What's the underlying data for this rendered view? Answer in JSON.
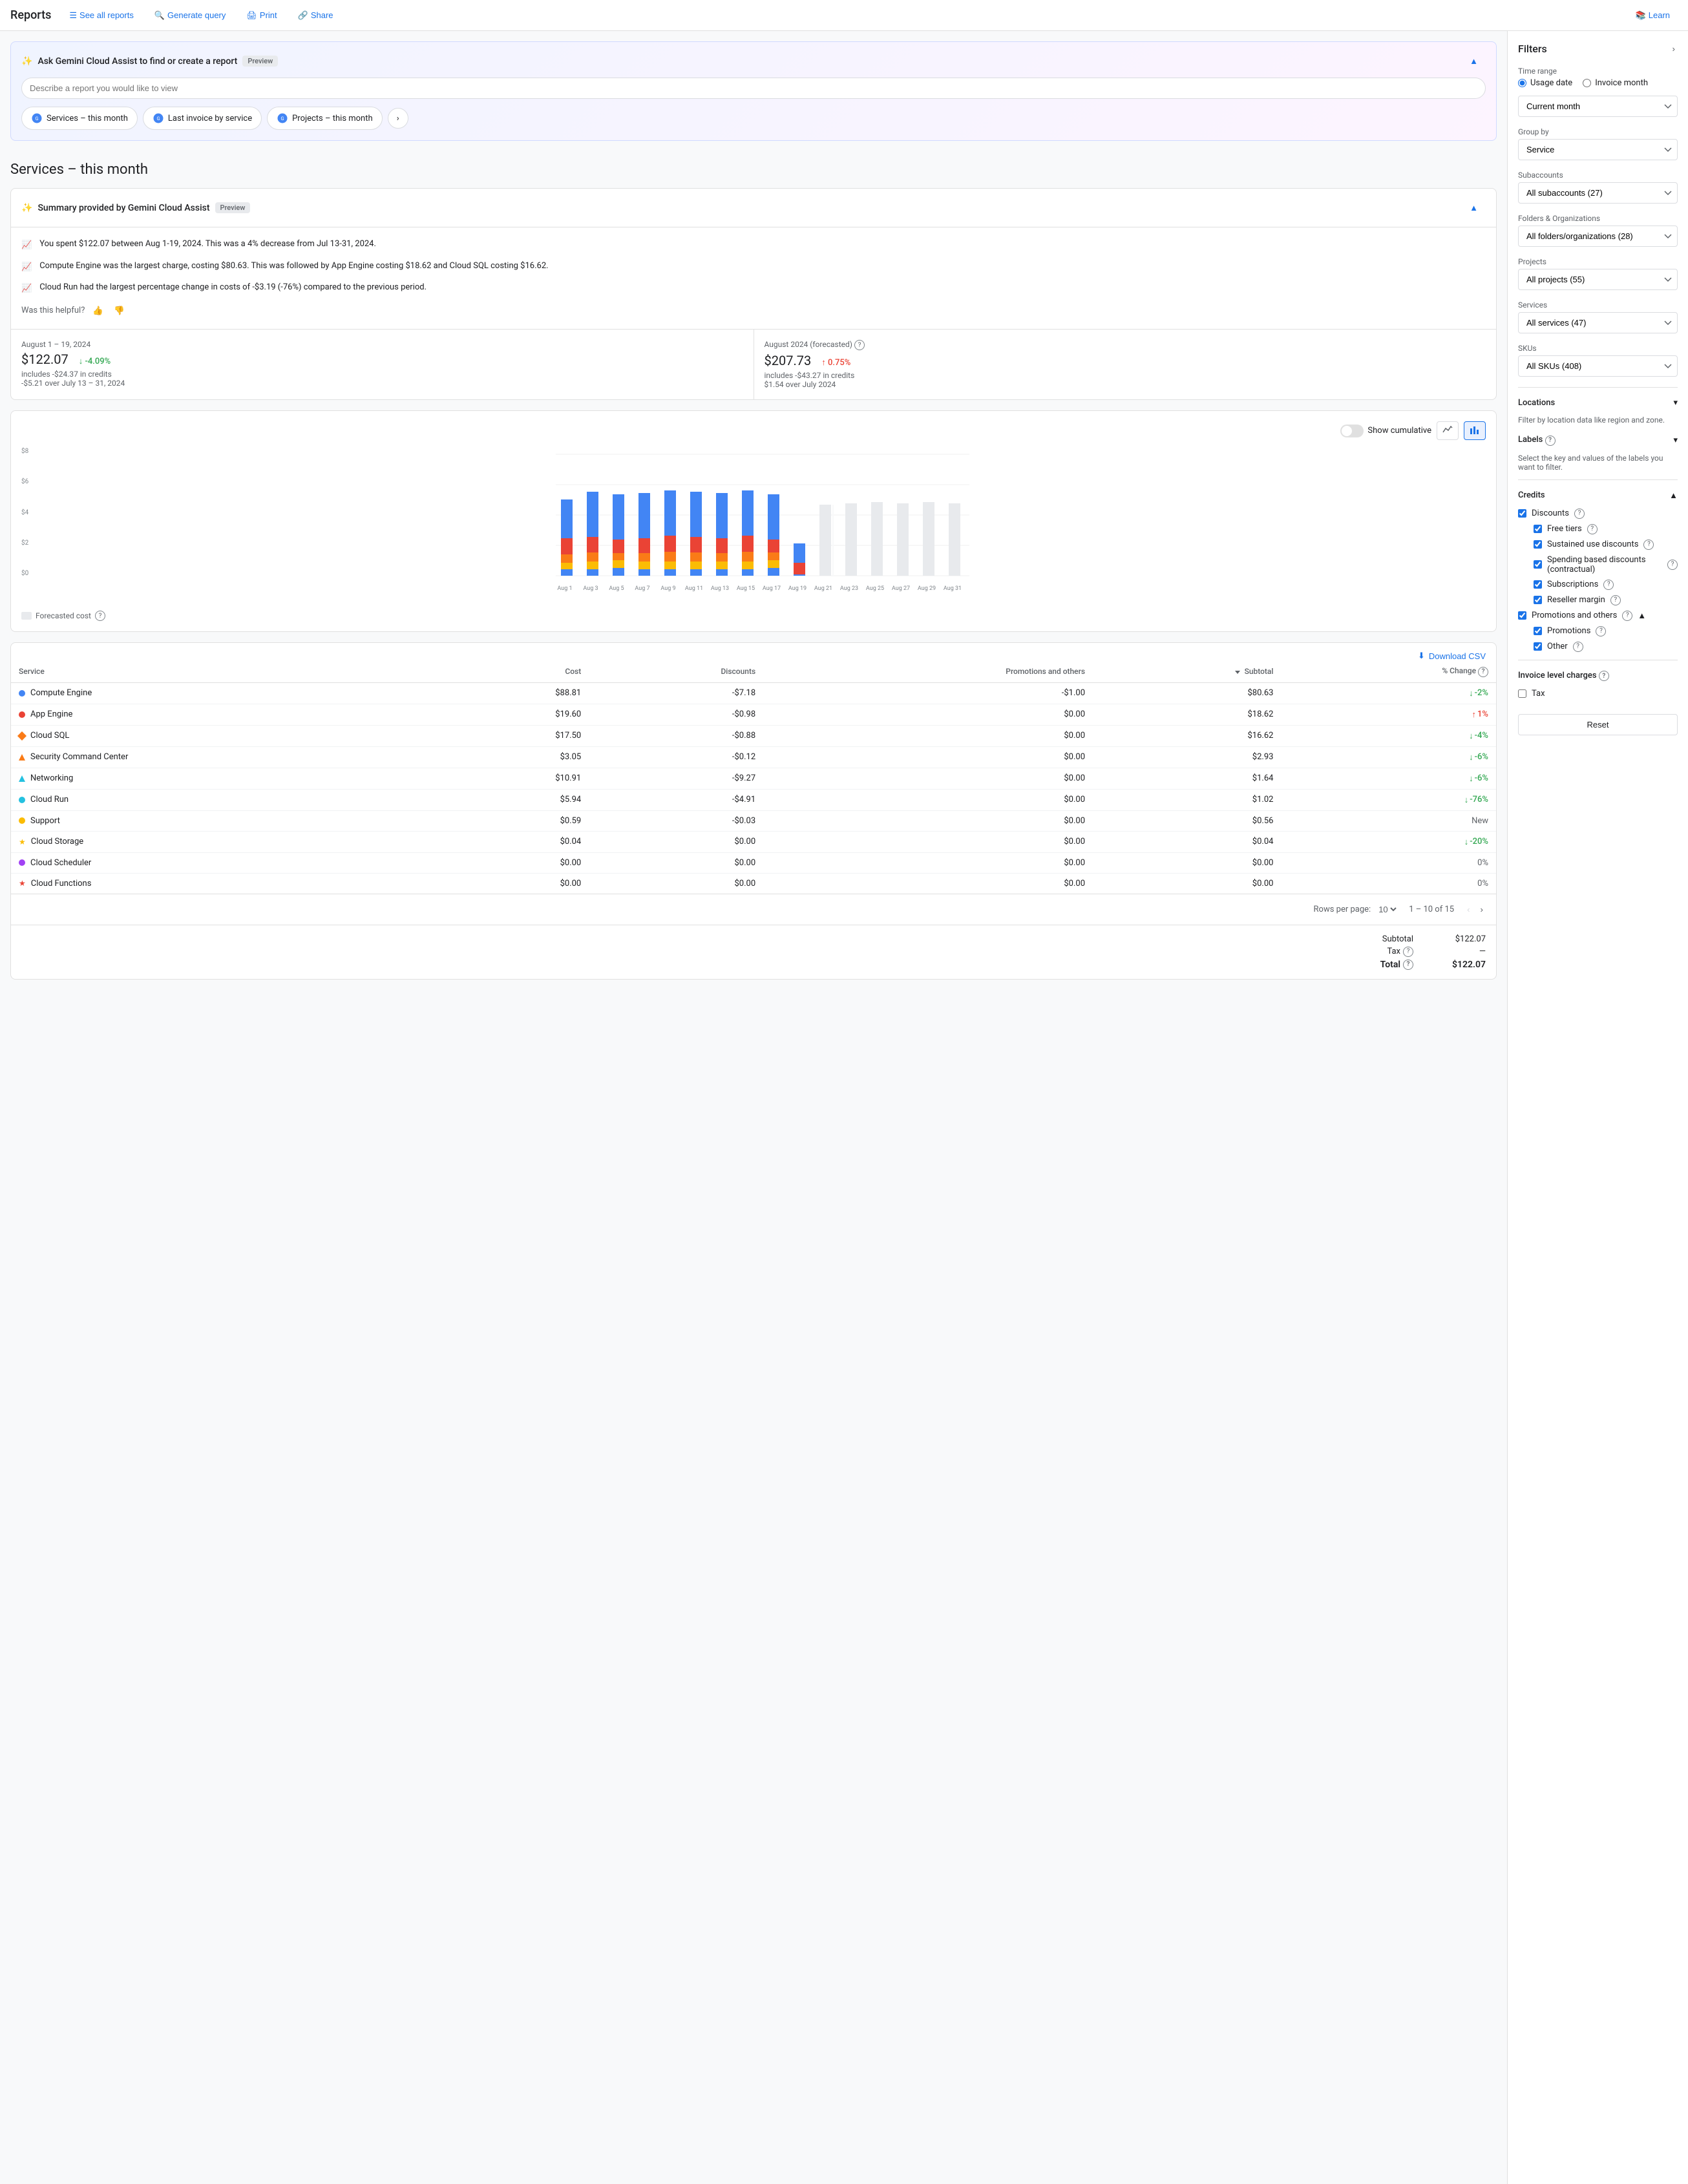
{
  "nav": {
    "title": "Reports",
    "see_all_reports": "See all reports",
    "generate_query": "Generate query",
    "print": "Print",
    "share": "Share",
    "learn": "Learn"
  },
  "gemini": {
    "title": "Ask Gemini Cloud Assist to find or create a report",
    "preview_badge": "Preview",
    "input_placeholder": "Describe a report you would like to view",
    "chips": [
      {
        "label": "Services – this month",
        "icon": "cloud"
      },
      {
        "label": "Last invoice by service",
        "icon": "cloud"
      },
      {
        "label": "Projects – this month",
        "icon": "cloud"
      }
    ]
  },
  "page_title": "Services – this month",
  "summary": {
    "title": "Summary provided by Gemini Cloud Assist",
    "preview_badge": "Preview",
    "items": [
      "You spent $122.07 between Aug 1-19, 2024. This was a 4% decrease from Jul 13-31, 2024.",
      "Compute Engine was the largest charge, costing $80.63. This was followed by App Engine costing $18.62 and Cloud SQL costing $16.62.",
      "Cloud Run had the largest percentage change in costs of -$3.19 (-76%) compared to the previous period."
    ],
    "feedback_label": "Was this helpful?"
  },
  "metrics": {
    "current": {
      "period": "August 1 – 19, 2024",
      "value": "$122.07",
      "sub": "includes -$24.37 in credits",
      "change": "↓ -4.09%",
      "change_type": "down",
      "change_sub": "-$5.21 over July 13 – 31, 2024"
    },
    "forecast": {
      "period": "August 2024 (forecasted)",
      "value": "$207.73",
      "sub": "includes -$43.27 in credits",
      "change": "↑ 0.75%",
      "change_type": "up",
      "change_sub": "$1.54 over July 2024"
    }
  },
  "chart": {
    "y_label": "$8",
    "y_labels": [
      "$8",
      "$6",
      "$4",
      "$2",
      "$0"
    ],
    "show_cumulative": "Show cumulative",
    "forecasted_label": "Forecasted cost",
    "x_labels": [
      "Aug 1",
      "Aug 3",
      "Aug 5",
      "Aug 7",
      "Aug 9",
      "Aug 11",
      "Aug 13",
      "Aug 15",
      "Aug 17",
      "Aug 19",
      "Aug 21",
      "Aug 23",
      "Aug 25",
      "Aug 27",
      "Aug 29",
      "Aug 31"
    ]
  },
  "table": {
    "download_label": "Download CSV",
    "columns": [
      "Service",
      "Cost",
      "Discounts",
      "Promotions and others",
      "Subtotal",
      "% Change"
    ],
    "rows": [
      {
        "name": "Compute Engine",
        "cost": "$88.81",
        "discounts": "-$7.18",
        "promotions": "-$1.00",
        "subtotal": "$80.63",
        "change": "-2%",
        "change_type": "down",
        "icon_type": "dot",
        "icon_color": "dot-blue"
      },
      {
        "name": "App Engine",
        "cost": "$19.60",
        "discounts": "-$0.98",
        "promotions": "$0.00",
        "subtotal": "$18.62",
        "change": "1%",
        "change_type": "up",
        "icon_type": "dot",
        "icon_color": "dot-red"
      },
      {
        "name": "Cloud SQL",
        "cost": "$17.50",
        "discounts": "-$0.88",
        "promotions": "$0.00",
        "subtotal": "$16.62",
        "change": "-4%",
        "change_type": "down",
        "icon_type": "diamond",
        "icon_color": "#fa7b17"
      },
      {
        "name": "Security Command Center",
        "cost": "$3.05",
        "discounts": "-$0.12",
        "promotions": "$0.00",
        "subtotal": "$2.93",
        "change": "-6%",
        "change_type": "down",
        "icon_type": "triangle",
        "icon_color": "#fa7b17"
      },
      {
        "name": "Networking",
        "cost": "$10.91",
        "discounts": "-$9.27",
        "promotions": "$0.00",
        "subtotal": "$1.64",
        "change": "-6%",
        "change_type": "down",
        "icon_type": "triangle",
        "icon_color": "#24c1e0"
      },
      {
        "name": "Cloud Run",
        "cost": "$5.94",
        "discounts": "-$4.91",
        "promotions": "$0.00",
        "subtotal": "$1.02",
        "change": "-76%",
        "change_type": "down",
        "icon_type": "dot",
        "icon_color": "dot-teal"
      },
      {
        "name": "Support",
        "cost": "$0.59",
        "discounts": "-$0.03",
        "promotions": "$0.00",
        "subtotal": "$0.56",
        "change": "New",
        "change_type": "neutral",
        "icon_type": "dot",
        "icon_color": "dot-yellow"
      },
      {
        "name": "Cloud Storage",
        "cost": "$0.04",
        "discounts": "$0.00",
        "promotions": "$0.00",
        "subtotal": "$0.04",
        "change": "-20%",
        "change_type": "down",
        "icon_type": "star",
        "icon_color": "#fbbc04"
      },
      {
        "name": "Cloud Scheduler",
        "cost": "$0.00",
        "discounts": "$0.00",
        "promotions": "$0.00",
        "subtotal": "$0.00",
        "change": "0%",
        "change_type": "neutral",
        "icon_type": "dot",
        "icon_color": "dot-purple"
      },
      {
        "name": "Cloud Functions",
        "cost": "$0.00",
        "discounts": "$0.00",
        "promotions": "$0.00",
        "subtotal": "$0.00",
        "change": "0%",
        "change_type": "neutral",
        "icon_type": "star",
        "icon_color": "#ea4335"
      }
    ],
    "pagination": {
      "rows_per_page": "10",
      "page_info": "1 – 10 of 15"
    }
  },
  "totals": {
    "subtotal_label": "Subtotal",
    "subtotal_value": "$122.07",
    "tax_label": "Tax",
    "tax_value": "—",
    "total_label": "Total",
    "total_value": "$122.07"
  },
  "sidebar": {
    "title": "Filters",
    "time_range_label": "Time range",
    "usage_date_label": "Usage date",
    "invoice_month_label": "Invoice month",
    "current_month_label": "Current month",
    "group_by_label": "Group by",
    "group_by_value": "Service",
    "subaccounts_label": "Subaccounts",
    "subaccounts_value": "All subaccounts (27)",
    "folders_label": "Folders & Organizations",
    "folders_value": "All folders/organizations (28)",
    "projects_label": "Projects",
    "projects_value": "All projects (55)",
    "services_label": "Services",
    "services_value": "All services (47)",
    "skus_label": "SKUs",
    "skus_value": "All SKUs (408)",
    "locations_label": "Locations",
    "locations_sub": "Filter by location data like region and zone.",
    "labels_label": "Labels",
    "labels_sub": "Select the key and values of the labels you want to filter.",
    "credits": {
      "title": "Credits",
      "discounts": "Discounts",
      "free_tiers": "Free tiers",
      "sustained_use": "Sustained use discounts",
      "spending_based": "Spending based discounts (contractual)",
      "subscriptions": "Subscriptions",
      "reseller_margin": "Reseller margin",
      "promotions": "Promotions and others",
      "promotions_sub": "Promotions",
      "other": "Other"
    },
    "invoice_charges": {
      "title": "Invoice level charges",
      "tax": "Tax"
    },
    "reset_label": "Reset"
  }
}
